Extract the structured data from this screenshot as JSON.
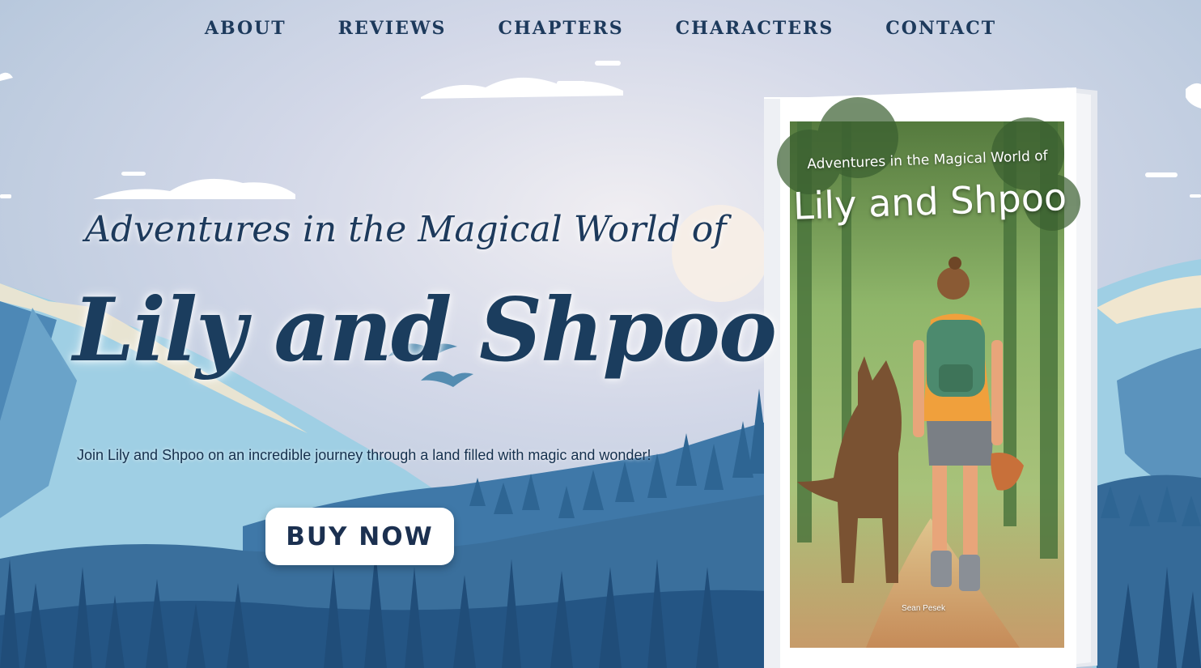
{
  "nav": {
    "items": [
      {
        "label": "ABOUT"
      },
      {
        "label": "REVIEWS"
      },
      {
        "label": "CHAPTERS"
      },
      {
        "label": "CHARACTERS"
      },
      {
        "label": "CONTACT"
      }
    ]
  },
  "hero": {
    "subtitle": "Adventures in the Magical World of",
    "title": "Lily and Shpoo",
    "description": "Join Lily and Shpoo on an incredible journey through a land filled with magic and wonder!",
    "buy_label": "BUY NOW"
  },
  "book": {
    "cover_subtitle": "Adventures in the Magical World of",
    "cover_title": "Lily and Shpoo",
    "author": "Sean Pesek"
  },
  "colors": {
    "primary": "#1d3a5c",
    "sky_top": "#b9c9dc",
    "sky_glow": "#e6e6f0",
    "mountain_light": "#a8d3e6",
    "mountain_mid": "#5b93bd",
    "forest_dark": "#2c5d8a",
    "button_bg": "#ffffff"
  }
}
